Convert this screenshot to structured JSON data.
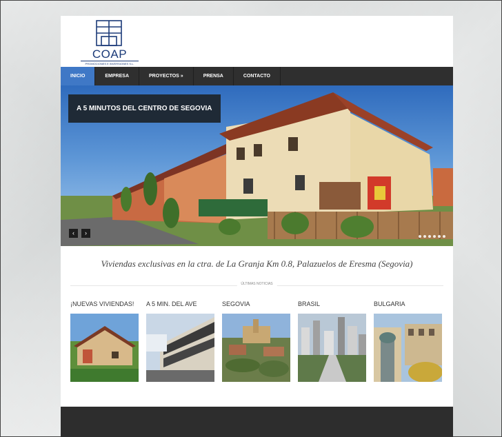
{
  "logo": {
    "name": "COAP",
    "subtitle": "PROMOCIONES E INVERSIONES S.L."
  },
  "nav": {
    "items": [
      {
        "label": "INICIO",
        "active": true
      },
      {
        "label": "EMPRESA"
      },
      {
        "label": "PROYECTOS »"
      },
      {
        "label": "PRENSA"
      },
      {
        "label": "CONTACTO"
      }
    ]
  },
  "hero": {
    "caption": "A 5 MINUTOS DEL CENTRO DE SEGOVIA",
    "prev_label": "‹",
    "next_label": "›"
  },
  "tagline": "Viviendas exclusivas en la ctra. de La Granja Km 0.8, Palazuelos de Eresma (Segovia)",
  "section_label": "ÚLTIMAS NOTICIAS",
  "news": [
    {
      "title": "¡NUEVAS VIVIENDAS!"
    },
    {
      "title": "A 5 MIN. DEL AVE"
    },
    {
      "title": "SEGOVIA"
    },
    {
      "title": "BRASIL"
    },
    {
      "title": "BULGARIA"
    }
  ],
  "colors": {
    "accent": "#3f78c6",
    "nav_bg": "#2f2f2f",
    "footer_bg": "#2d2d2d",
    "brand": "#1b3a78"
  }
}
